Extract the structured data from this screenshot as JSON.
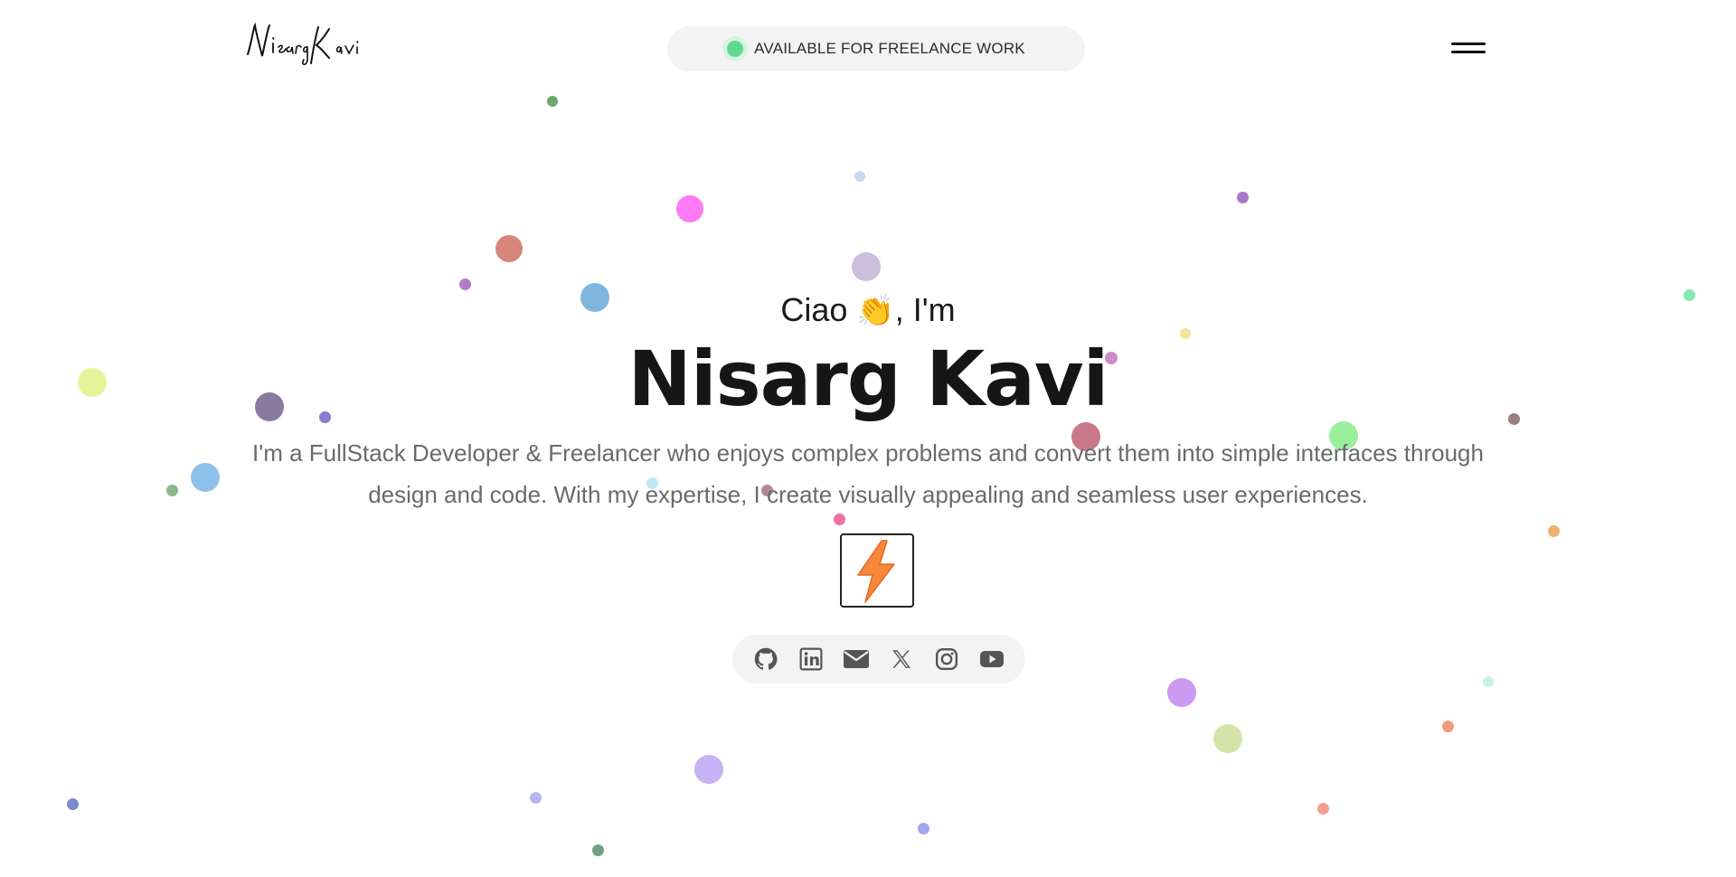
{
  "header": {
    "logo_text": "Nisarg Kavi",
    "status_text": "AVAILABLE FOR FREELANCE WORK",
    "status_color": "#5fd98c",
    "menu_icon": "hamburger-menu-icon"
  },
  "hero": {
    "greeting_before": "Ciao",
    "greeting_emoji": "👏",
    "greeting_after": ", I'm",
    "name": "Nisarg Kavi",
    "description": "I'm a FullStack Developer & Freelancer who enjoys complex problems and convert them into simple interfaces through design and code. With my expertise, I create visually appealing and seamless user experiences.",
    "badge_icon": "lightning-bolt-icon",
    "badge_color": "#f7873a"
  },
  "social_links": [
    {
      "icon": "github-icon"
    },
    {
      "icon": "linkedin-icon"
    },
    {
      "icon": "email-icon"
    },
    {
      "icon": "x-twitter-icon"
    },
    {
      "icon": "instagram-icon"
    },
    {
      "icon": "youtube-icon"
    }
  ],
  "colors": {
    "text_primary": "#161616",
    "text_secondary": "#6a6a6a",
    "pill_background": "#f3f3f3"
  }
}
